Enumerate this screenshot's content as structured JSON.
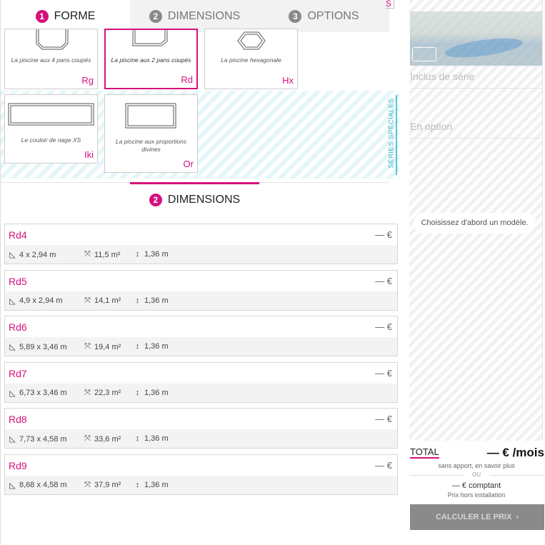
{
  "tabs": [
    {
      "num": "1",
      "label": "FORME"
    },
    {
      "num": "2",
      "label": "DIMENSIONS"
    },
    {
      "num": "3",
      "label": "OPTIONS"
    }
  ],
  "tab_overflow": "S",
  "shapes": [
    {
      "label": "La piscine aux 4 pans coupés",
      "code": "Rg"
    },
    {
      "label": "La piscine aux 2 pans coupés",
      "code": "Rd",
      "selected": true
    },
    {
      "label": "La piscine hexagonale",
      "code": "Hx"
    }
  ],
  "special_series": {
    "label": "SÉRIES SPÉCIALES",
    "items": [
      {
        "label": "Le couloir de nage XS",
        "code": "Iki"
      },
      {
        "label": "La piscine aux proportions divines",
        "code": "Or"
      }
    ]
  },
  "dimensions": {
    "num": "2",
    "title": "DIMENSIONS",
    "models": [
      {
        "name": "Rd4",
        "price": "— €",
        "size": "4 x 2,94 m",
        "area": "11,5 m²",
        "depth": "1,36 m"
      },
      {
        "name": "Rd5",
        "price": "— €",
        "size": "4,9 x 2,94 m",
        "area": "14,1 m²",
        "depth": "1,36 m"
      },
      {
        "name": "Rd6",
        "price": "— €",
        "size": "5,89 x 3,46 m",
        "area": "19,4 m²",
        "depth": "1,36 m"
      },
      {
        "name": "Rd7",
        "price": "— €",
        "size": "6,73 x 3,46 m",
        "area": "22,3 m²",
        "depth": "1,36 m"
      },
      {
        "name": "Rd8",
        "price": "— €",
        "size": "7,73 x 4,58 m",
        "area": "33,6 m²",
        "depth": "1,36 m"
      },
      {
        "name": "Rd9",
        "price": "— €",
        "size": "8,68 x 4,58 m",
        "area": "37,9 m²",
        "depth": "1,36 m"
      }
    ]
  },
  "sidebar": {
    "included_label": "Inclus de série",
    "option_label": "En option",
    "choose_message": "Choisissez d'abord un modèle.",
    "total_label": "TOTAL",
    "total_value": "— € /mois",
    "note": "sans apport, en savoir plus",
    "or_label": "OU",
    "cash_value": "— € comptant",
    "install_note": "Prix hors installation",
    "cta_label": "CALCULER LE PRIX",
    "cta_icon": "chevron-right-icon"
  },
  "colors": {
    "accent": "#d6117c",
    "special": "#39b6c7",
    "cta_bg": "#8a8a8a"
  }
}
